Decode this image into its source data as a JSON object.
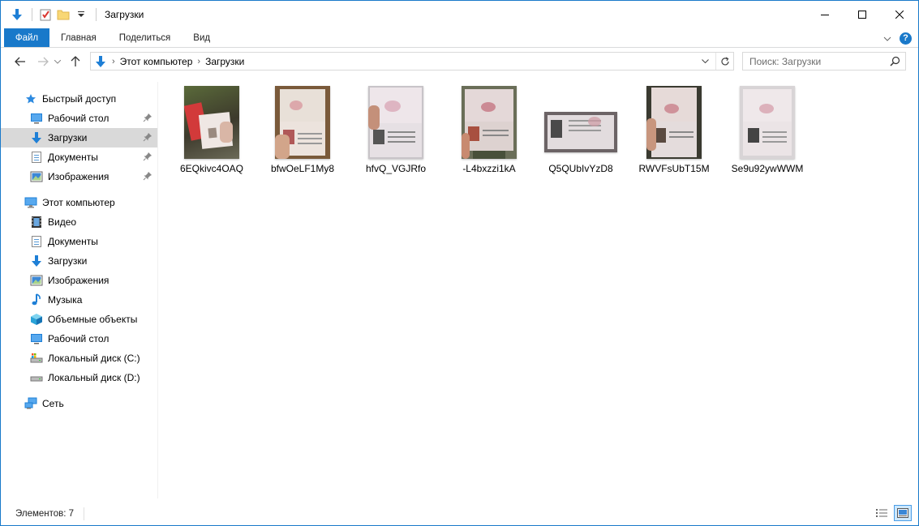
{
  "window": {
    "title": "Загрузки"
  },
  "ribbon": {
    "tabs": [
      {
        "label": "Файл"
      },
      {
        "label": "Главная"
      },
      {
        "label": "Поделиться"
      },
      {
        "label": "Вид"
      }
    ]
  },
  "address": {
    "segments": [
      "Этот компьютер",
      "Загрузки"
    ]
  },
  "search": {
    "placeholder": "Поиск: Загрузки"
  },
  "navpane": {
    "quick_access": {
      "label": "Быстрый доступ",
      "items": [
        {
          "label": "Рабочий стол",
          "icon": "desktop-icon",
          "pinned": true
        },
        {
          "label": "Загрузки",
          "icon": "downloads-icon",
          "pinned": true,
          "selected": true
        },
        {
          "label": "Документы",
          "icon": "documents-icon",
          "pinned": true
        },
        {
          "label": "Изображения",
          "icon": "pictures-icon",
          "pinned": true
        }
      ]
    },
    "this_pc": {
      "label": "Этот компьютер",
      "items": [
        {
          "label": "Видео",
          "icon": "video-icon"
        },
        {
          "label": "Документы",
          "icon": "documents-icon"
        },
        {
          "label": "Загрузки",
          "icon": "downloads-icon"
        },
        {
          "label": "Изображения",
          "icon": "pictures-icon"
        },
        {
          "label": "Музыка",
          "icon": "music-icon"
        },
        {
          "label": "Объемные объекты",
          "icon": "3d-objects-icon"
        },
        {
          "label": "Рабочий стол",
          "icon": "desktop-icon"
        },
        {
          "label": "Локальный диск (C:)",
          "icon": "drive-c-icon"
        },
        {
          "label": "Локальный диск (D:)",
          "icon": "drive-d-icon"
        }
      ]
    },
    "network": {
      "label": "Сеть"
    }
  },
  "files": [
    {
      "name": "6EQkivc4OAQ"
    },
    {
      "name": "bfwOeLF1My8"
    },
    {
      "name": "hfvQ_VGJRfo"
    },
    {
      "name": "-L4bxzzi1kA"
    },
    {
      "name": "Q5QUbIvYzD8"
    },
    {
      "name": "RWVFsUbT15M"
    },
    {
      "name": "Se9u92ywWWM"
    }
  ],
  "status": {
    "count_text": "Элементов: 7"
  },
  "colors": {
    "accent": "#1979ca",
    "selection": "#d9d9d9"
  }
}
